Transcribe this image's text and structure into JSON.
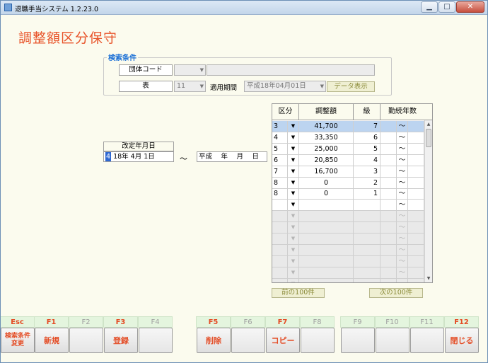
{
  "window": {
    "title": "退職手当システム 1.2.23.0",
    "min_icon": "minimize-icon",
    "max_icon": "maximize-icon",
    "close_icon": "close-icon",
    "min_glyph": "▁",
    "max_glyph": "□",
    "close_glyph": "✕"
  },
  "page": {
    "title": "調整額区分保守"
  },
  "search": {
    "legend": "検索条件",
    "group_code_label": "団体コード",
    "group_code_value": "",
    "group_name_value": "",
    "table_label": "表",
    "table_value": "11",
    "period_label": "適用期間",
    "period_value": "平成18年04月01日",
    "data_button": "データ表示"
  },
  "revision": {
    "label": "改定年月日",
    "from_era_char": "4",
    "from_rest": " 18年 4月 1日",
    "tilde": "～",
    "to_value": "平成　 年　 月　 日"
  },
  "grid": {
    "headers": {
      "kubun": "区分",
      "amount": "調整額",
      "grade": "級",
      "years": "勤続年数"
    },
    "dropdown_glyph": "▼",
    "tilde": "～",
    "rows": [
      {
        "kubun": "3",
        "amount": "41,700",
        "grade": "7"
      },
      {
        "kubun": "4",
        "amount": "33,350",
        "grade": "6"
      },
      {
        "kubun": "5",
        "amount": "25,000",
        "grade": "5"
      },
      {
        "kubun": "6",
        "amount": "20,850",
        "grade": "4"
      },
      {
        "kubun": "7",
        "amount": "16,700",
        "grade": "3"
      },
      {
        "kubun": "8",
        "amount": "0",
        "grade": "2"
      },
      {
        "kubun": "8",
        "amount": "0",
        "grade": "1"
      },
      {
        "kubun": "",
        "amount": "",
        "grade": ""
      }
    ],
    "disabled_row_count": 7,
    "selected_row": 0
  },
  "paging": {
    "prev": "前の100件",
    "next": "次の100件"
  },
  "fkeys": [
    {
      "key": "Esc",
      "label": "検索条件\n変更",
      "enabled": true
    },
    {
      "key": "F1",
      "label": "新規",
      "enabled": true
    },
    {
      "key": "F2",
      "label": "",
      "enabled": false
    },
    {
      "key": "F3",
      "label": "登録",
      "enabled": true
    },
    {
      "key": "F4",
      "label": "",
      "enabled": false
    },
    {
      "key": "F5",
      "label": "削除",
      "enabled": true
    },
    {
      "key": "F6",
      "label": "",
      "enabled": false
    },
    {
      "key": "F7",
      "label": "コピー",
      "enabled": true
    },
    {
      "key": "F8",
      "label": "",
      "enabled": false
    },
    {
      "key": "F9",
      "label": "",
      "enabled": false
    },
    {
      "key": "F10",
      "label": "",
      "enabled": false
    },
    {
      "key": "F11",
      "label": "",
      "enabled": false
    },
    {
      "key": "F12",
      "label": "閉じる",
      "enabled": true
    }
  ],
  "colors": {
    "accent": "#e8542a",
    "legend": "#1a6fd6",
    "fkey_bar": "#e4f5de"
  }
}
